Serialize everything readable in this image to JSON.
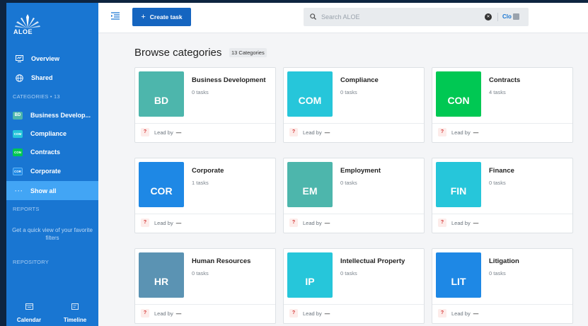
{
  "app": {
    "logo_text": "ALOE"
  },
  "sidebar": {
    "nav": [
      {
        "label": "Overview",
        "icon": "overview-icon"
      },
      {
        "label": "Shared",
        "icon": "globe-icon"
      }
    ],
    "categories_label": "CATEGORIES • 13",
    "categories": [
      {
        "abbr": "BD",
        "label": "Business Develop...",
        "color": "#4db6ac"
      },
      {
        "abbr": "COM",
        "label": "Compliance",
        "color": "#26c6da"
      },
      {
        "abbr": "CON",
        "label": "Contracts",
        "color": "#00c853"
      },
      {
        "abbr": "COR",
        "label": "Corporate",
        "color": "#1e88e5"
      }
    ],
    "show_all": {
      "dots": "···",
      "label": "Show all"
    },
    "reports_label": "REPORTS",
    "reports_hint": "Get a quick view of your favorite filters",
    "repository_label": "REPOSITORY",
    "bottom_tabs": [
      {
        "label": "Calendar",
        "icon": "calendar-icon"
      },
      {
        "label": "Timeline",
        "icon": "timeline-icon"
      }
    ]
  },
  "topbar": {
    "create_label": "Create task",
    "create_icon": "+",
    "search_placeholder": "Search ALOE",
    "clear_icon": "✕",
    "close_label": "Clo"
  },
  "main": {
    "heading": "Browse categories",
    "count": "13 Categories",
    "lead_label": "Lead by",
    "lead_value": "—",
    "cards": [
      {
        "abbr": "BD",
        "name": "Business Development",
        "tasks": "0 tasks",
        "color": "#4db6ac"
      },
      {
        "abbr": "COM",
        "name": "Compliance",
        "tasks": "0 tasks",
        "color": "#26c6da"
      },
      {
        "abbr": "CON",
        "name": "Contracts",
        "tasks": "4 tasks",
        "color": "#00c853"
      },
      {
        "abbr": "COR",
        "name": "Corporate",
        "tasks": "1 tasks",
        "color": "#1e88e5"
      },
      {
        "abbr": "EM",
        "name": "Employment",
        "tasks": "0 tasks",
        "color": "#4db6ac"
      },
      {
        "abbr": "FIN",
        "name": "Finance",
        "tasks": "0 tasks",
        "color": "#26c6da"
      },
      {
        "abbr": "HR",
        "name": "Human Resources",
        "tasks": "0 tasks",
        "color": "#5b93b3"
      },
      {
        "abbr": "IP",
        "name": "Intellectual Property",
        "tasks": "0 tasks",
        "color": "#26c6da"
      },
      {
        "abbr": "LIT",
        "name": "Litigation",
        "tasks": "0 tasks",
        "color": "#1e88e5"
      }
    ]
  }
}
